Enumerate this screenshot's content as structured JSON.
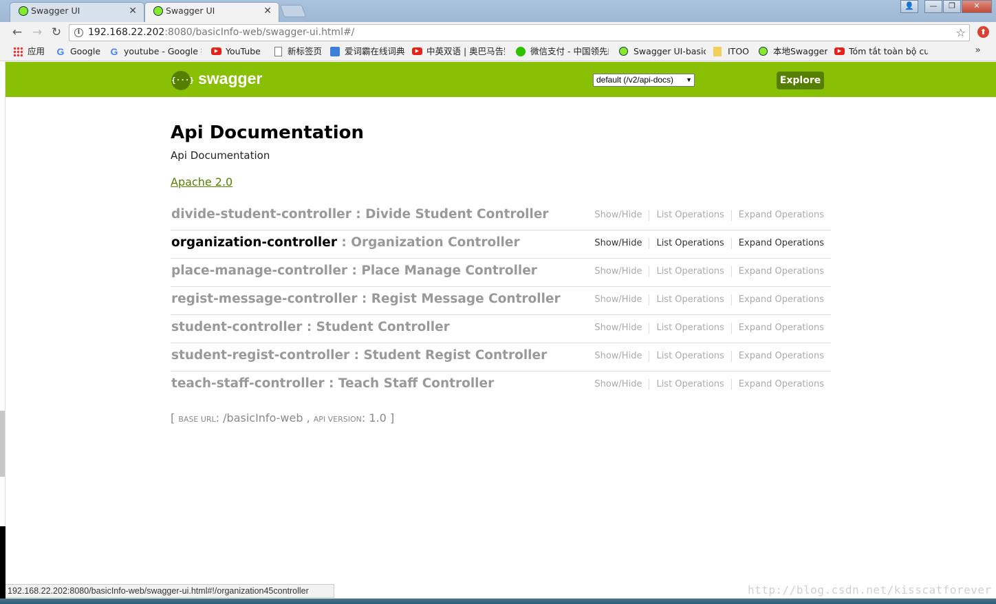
{
  "browser": {
    "tabs": [
      {
        "title": "Swagger UI",
        "close": "✕"
      },
      {
        "title": "Swagger UI",
        "close": "✕"
      }
    ],
    "window_buttons": {
      "user": "👤",
      "minimize": "—",
      "maximize": "❐",
      "close": "✕"
    },
    "nav": {
      "back": "←",
      "forward": "→",
      "reload": "↻"
    },
    "url": {
      "info": "i",
      "host": "192.168.22.202",
      "rest": ":8080/basicInfo-web/swagger-ui.html#/",
      "star": "☆"
    },
    "extension": "⬆",
    "bookmarks": [
      {
        "label": "应用",
        "icon": "apps-icon"
      },
      {
        "label": "Google",
        "icon": "google-icon"
      },
      {
        "label": "youtube - Google 搜",
        "icon": "google-icon"
      },
      {
        "label": "YouTube",
        "icon": "youtube-icon"
      },
      {
        "label": "新标签页",
        "icon": "page-icon"
      },
      {
        "label": "爱词霸在线词典",
        "icon": "dictionary-icon"
      },
      {
        "label": "中英双语 | 奥巴马告别",
        "icon": "youtube-icon"
      },
      {
        "label": "微信支付 - 中国领先的",
        "icon": "wechat-icon"
      },
      {
        "label": "Swagger UI-basic",
        "icon": "swagger-icon"
      },
      {
        "label": "ITOO",
        "icon": "folder-icon"
      },
      {
        "label": "本地Swagger",
        "icon": "swagger-icon"
      },
      {
        "label": "Tóm tắt toàn bộ cuộc",
        "icon": "youtube-icon"
      }
    ],
    "bookmarks_more": "»",
    "status_url": "192.168.22.202:8080/basicInfo-web/swagger-ui.html#!/organization45controller"
  },
  "swagger": {
    "logo_glyph": "{···}",
    "logo_text": "swagger",
    "spec_select": "default (/v2/api-docs)",
    "spec_caret": "▼",
    "explore_label": "Explore",
    "info": {
      "title": "Api Documentation",
      "description": "Api Documentation",
      "license": "Apache 2.0"
    },
    "operation_labels": {
      "show_hide": "Show/Hide",
      "list": "List Operations",
      "expand": "Expand Operations"
    },
    "resources": [
      {
        "name": "divide-student-controller",
        "description": "Divide Student Controller"
      },
      {
        "name": "organization-controller",
        "description": "Organization Controller"
      },
      {
        "name": "place-manage-controller",
        "description": "Place Manage Controller"
      },
      {
        "name": "regist-message-controller",
        "description": "Regist Message Controller"
      },
      {
        "name": "student-controller",
        "description": "Student Controller"
      },
      {
        "name": "student-regist-controller",
        "description": "Student Regist Controller"
      },
      {
        "name": "teach-staff-controller",
        "description": "Teach Staff Controller"
      }
    ],
    "separator": " : ",
    "footer": {
      "open": "[ ",
      "base_url_label": "BASE URL",
      "base_url": "/basicInfo-web",
      "comma": " , ",
      "api_version_label": "API VERSION",
      "api_version": "1.0",
      "close": " ]"
    }
  },
  "watermark": "http://blog.csdn.net/kisscatforever",
  "colors": {
    "swagger_green": "#89bf04",
    "swagger_dark_green": "#547f00"
  }
}
